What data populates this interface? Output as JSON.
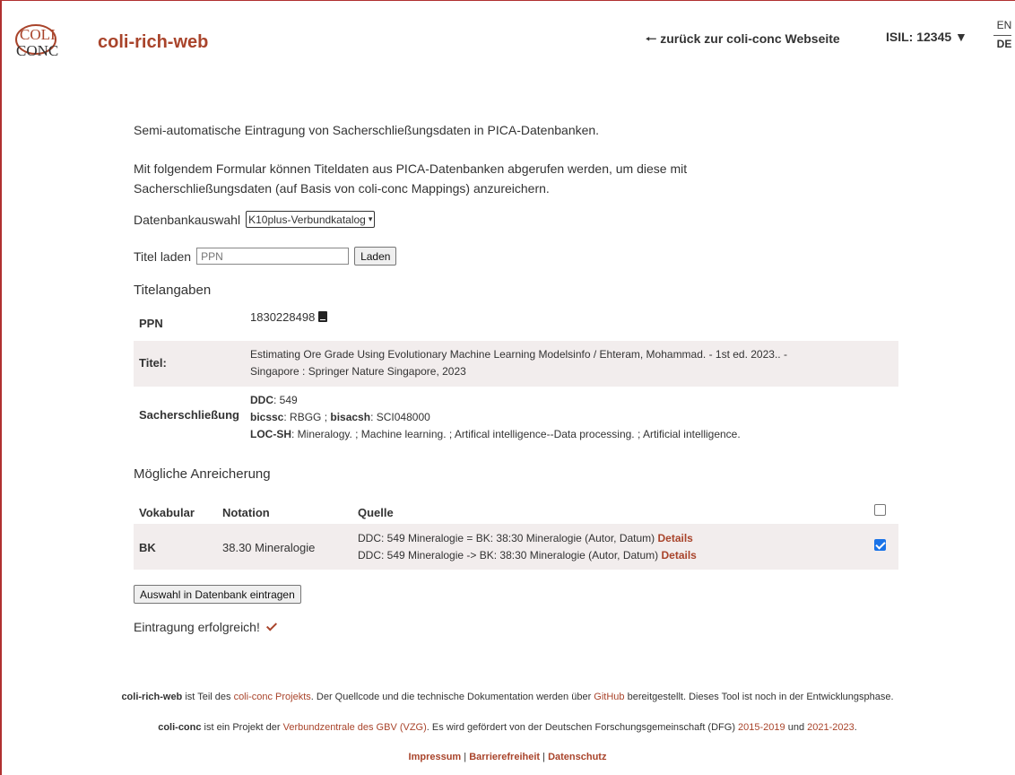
{
  "header": {
    "logo_top": "COLI",
    "logo_bottom": "CONC",
    "app_title": "coli-rich-web",
    "back_link": "zurück zur coli-conc Webseite",
    "isil": "ISIL: 12345",
    "lang_en": "EN",
    "lang_de": "DE"
  },
  "intro": {
    "line1": "Semi-automatische Eintragung von Sacherschließungsdaten in PICA-Datenbanken.",
    "line2": "Mit folgendem Formular können Titeldaten aus PICA-Datenbanken abgerufen werden, um diese mit Sacherschließungsdaten (auf Basis von coli-conc Mappings) anzureichern."
  },
  "form": {
    "db_label": "Datenbankauswahl",
    "db_selected": "K10plus-Verbundkatalog",
    "title_label": "Titel laden",
    "ppn_placeholder": "PPN",
    "load_button": "Laden"
  },
  "title_info": {
    "heading": "Titelangaben",
    "ppn_label": "PPN",
    "ppn_value": "1830228498",
    "title_label": "Titel:",
    "title_line1": "Estimating Ore Grade Using Evolutionary Machine Learning Modelsinfo / Ehteram, Mohammad. - 1st ed. 2023.. -",
    "title_line2": "Singapore : Springer Nature Singapore, 2023",
    "subject_label": "Sacherschließung",
    "ddc_key": "DDC",
    "ddc_value": ": 549",
    "bicssc_key": "bicssc",
    "bicssc_value": ": RBGG ; ",
    "bisacsh_key": "bisacsh",
    "bisacsh_value": ": SCI048000",
    "locsh_key": "LOC-SH",
    "locsh_value": ": Mineralogy. ; Machine learning. ; Artifical intelligence--Data processing. ; Artificial intelligence."
  },
  "enrichment": {
    "heading": "Mögliche Anreicherung",
    "columns": [
      "Vokabular",
      "Notation",
      "Quelle"
    ],
    "header_checked": false,
    "rows": [
      {
        "vocabulary": "BK",
        "notation": "38.30 Mineralogie",
        "sources": [
          {
            "text": "DDC: 549 Mineralogie = BK: 38:30 Mineralogie (Autor, Datum) ",
            "link": "Details"
          },
          {
            "text": "DDC: 549 Mineralogie -> BK: 38:30 Mineralogie (Autor, Datum) ",
            "link": "Details"
          }
        ],
        "checked": true
      }
    ],
    "save_button": "Auswahl in Datenbank eintragen",
    "success_message": "Eintragung erfolgreich!"
  },
  "footer": {
    "l1_name": "coli-rich-web",
    "l1_a": " ist Teil des ",
    "l1_link1": "coli-conc Projekts",
    "l1_b": ". Der Quellcode und die technische Dokumentation werden über ",
    "l1_link2": "GitHub",
    "l1_c": " bereitgestellt. Dieses Tool ist noch in der Entwicklungsphase.",
    "l2_name": "coli-conc",
    "l2_a": " ist ein Projekt der ",
    "l2_link1": "Verbundzentrale des GBV (VZG)",
    "l2_b": ". Es wird gefördert von der Deutschen Forschungsgemeinschaft (DFG) ",
    "l2_link2": "2015-2019",
    "l2_c": " und ",
    "l2_link3": "2021-2023",
    "l2_d": ".",
    "impressum": "Impressum",
    "barrierefreiheit": "Barrierefreiheit",
    "datenschutz": "Datenschutz",
    "sep": " | "
  },
  "colors": {
    "accent": "#a9442b",
    "row_alt": "#f2eded",
    "checkbox": "#1a73e8"
  }
}
